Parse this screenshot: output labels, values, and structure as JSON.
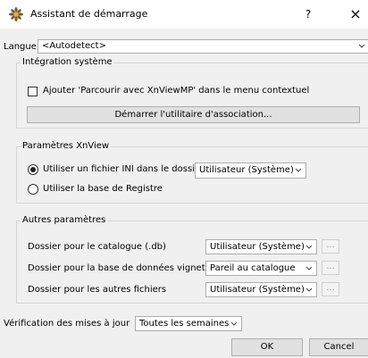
{
  "window": {
    "title": "Assistant de démarrage",
    "help": "?",
    "close": "×"
  },
  "language": {
    "label": "Langue",
    "value": "<Autodetect>"
  },
  "integration": {
    "title": "Intégration système",
    "checkbox_label": "Ajouter 'Parcourir avec XnViewMP' dans le menu contextuel",
    "checkbox_checked": false,
    "assoc_button": "Démarrer l'utilitaire d'association..."
  },
  "xnview": {
    "title": "Paramètres XnView",
    "radio_ini_label": "Utiliser un fichier INI dans le dossier",
    "radio_ini_value": "Utilisateur (Système)",
    "radio_registry_label": "Utiliser la base de Registre",
    "selected": "ini"
  },
  "other": {
    "title": "Autres paramètres",
    "rows": [
      {
        "label": "Dossier pour le catalogue (.db)",
        "value": "Utilisateur (Système)",
        "browse": "..."
      },
      {
        "label": "Dossier pour la base de données vignettes",
        "value": "Pareil au catalogue",
        "browse": "..."
      },
      {
        "label": "Dossier pour les autres fichiers",
        "value": "Utilisateur (Système)",
        "browse": "..."
      }
    ]
  },
  "updates": {
    "label": "Vérification des mises à jour",
    "value": "Toutes les semaines"
  },
  "buttons": {
    "ok": "OK",
    "cancel": "Cancel"
  }
}
